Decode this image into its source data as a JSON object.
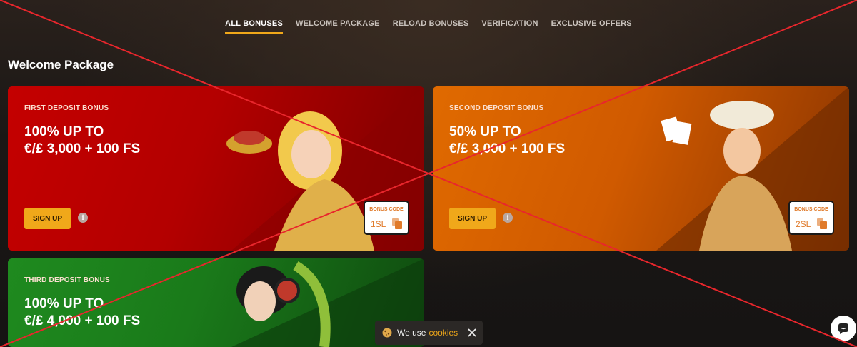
{
  "nav": {
    "tabs": [
      {
        "label": "ALL BONUSES",
        "active": true
      },
      {
        "label": "WELCOME PACKAGE",
        "active": false
      },
      {
        "label": "RELOAD BONUSES",
        "active": false
      },
      {
        "label": "VERIFICATION",
        "active": false
      },
      {
        "label": "EXCLUSIVE OFFERS",
        "active": false
      }
    ]
  },
  "section": {
    "title": "Welcome Package"
  },
  "cards": [
    {
      "label": "FIRST DEPOSIT BONUS",
      "offer_line1": "100% UP TO",
      "offer_line2": "€/£ 3,000 + 100 FS",
      "signup": "SIGN UP",
      "info": "i",
      "code_label": "BONUS CODE",
      "code": "1SL"
    },
    {
      "label": "SECOND DEPOSIT BONUS",
      "offer_line1": "50% UP TO",
      "offer_line2": "€/£ 3,000 + 100 FS",
      "signup": "SIGN UP",
      "info": "i",
      "code_label": "BONUS CODE",
      "code": "2SL"
    },
    {
      "label": "THIRD DEPOSIT BONUS",
      "offer_line1": "100% UP TO",
      "offer_line2": "€/£ 4,000 + 100 FS"
    }
  ],
  "cookie": {
    "text": "We use",
    "link": "cookies"
  },
  "colors": {
    "accent": "#f0a81a",
    "card1": "#c40000",
    "card2": "#e06a00",
    "card3": "#1f8a1f",
    "cross": "#e8262c"
  },
  "icons": [
    "copy-icon",
    "info-icon",
    "cookie-icon",
    "close-icon",
    "chat-icon"
  ]
}
